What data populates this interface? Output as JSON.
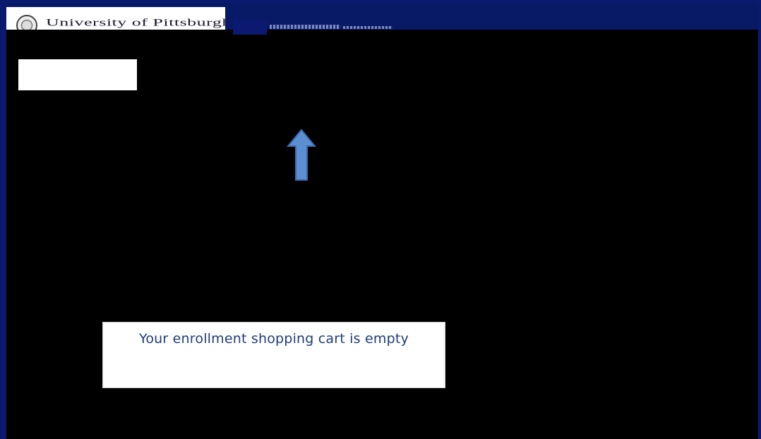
{
  "header": {
    "university_name": "University of Pittsburgh"
  },
  "cart": {
    "empty_message": "Your enrollment shopping cart is empty"
  },
  "colors": {
    "frame": "#0a1a6e",
    "header": "#081a66",
    "background": "#000000",
    "message_text": "#1f3d7a",
    "arrow_fill": "#5b8fd1",
    "arrow_stroke": "#3b6db0"
  },
  "icons": {
    "logo": "university-seal-icon",
    "pointer": "up-arrow-icon"
  }
}
